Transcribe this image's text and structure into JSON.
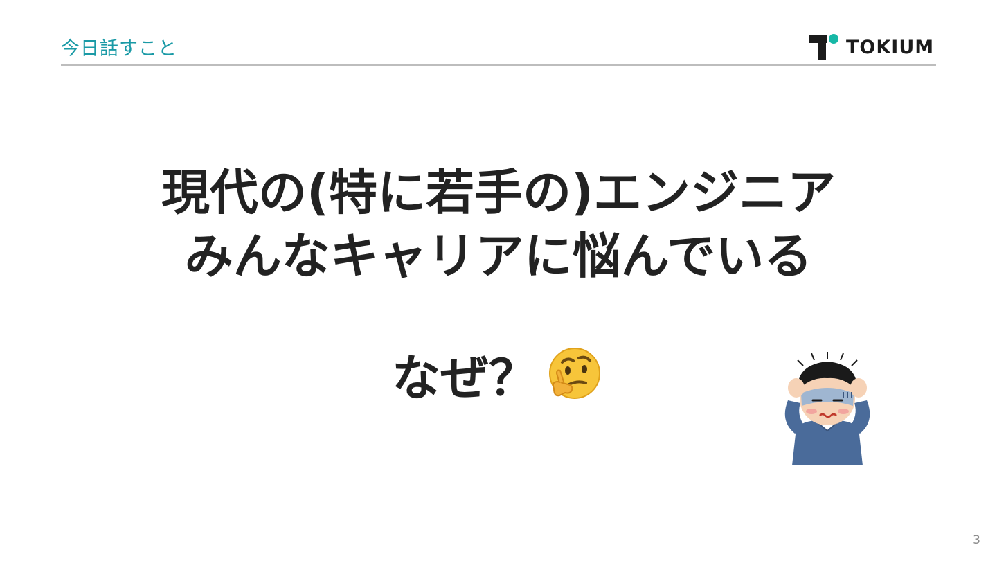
{
  "header": {
    "section_title": "今日話すこと",
    "logo_text": "TOKIUM",
    "accent_color": "#1a9aa6",
    "logo_dot_color": "#16b8a6"
  },
  "main": {
    "headline_line1": "現代の(特に若手の)エンジニア",
    "headline_line2": "みんなキャリアに悩んでいる",
    "question": "なぜ？",
    "question_icon": "thinking-face-icon",
    "illustration": "worried-person-holding-head"
  },
  "footer": {
    "page_number": "3"
  }
}
